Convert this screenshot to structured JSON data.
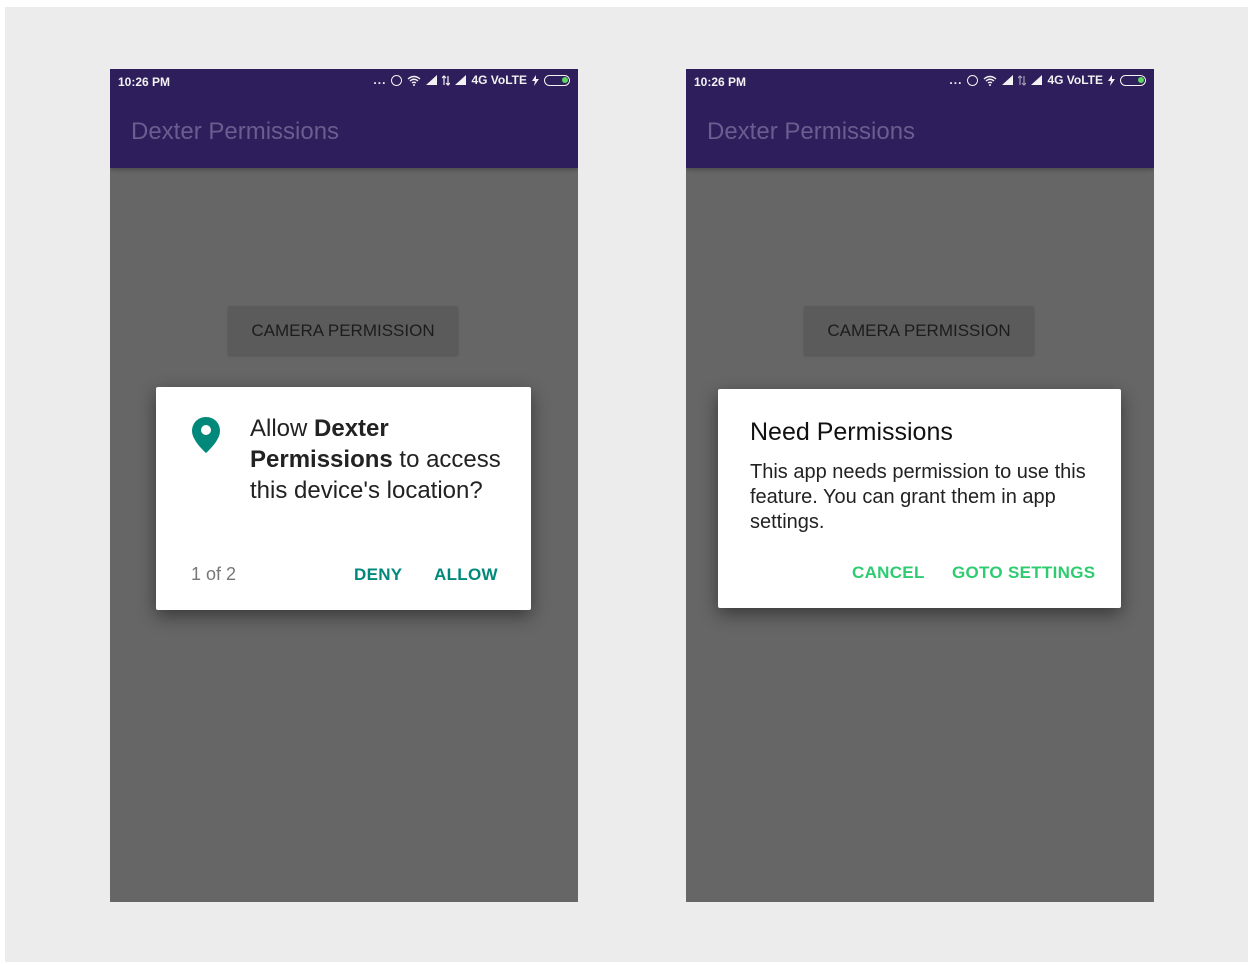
{
  "colors": {
    "app_bar": "#2e1e5b",
    "app_title": "#6a5d8f",
    "screen_scrim": "#666666",
    "allow_accent": "#00897b",
    "settings_accent": "#2ecc71",
    "battery_fill": "#5cd65c"
  },
  "screens": [
    {
      "status_bar": {
        "time": "10:26 PM",
        "dots": "...",
        "network": "4G VoLTE"
      },
      "app_title": "Dexter Permissions",
      "camera_button": "CAMERA PERMISSION",
      "dialog": {
        "type": "system-permission",
        "icon": "location-pin-icon",
        "text_prefix": "Allow ",
        "app_name": "Dexter Permissions",
        "text_suffix": " to access this device's location?",
        "counter": "1 of 2",
        "deny_label": "DENY",
        "allow_label": "ALLOW"
      }
    },
    {
      "status_bar": {
        "time": "10:26 PM",
        "dots": "...",
        "network": "4G VoLTE"
      },
      "app_title": "Dexter Permissions",
      "camera_button": "CAMERA PERMISSION",
      "dialog": {
        "type": "custom",
        "title": "Need Permissions",
        "message": "This app needs permission to use this feature. You can grant them in app settings.",
        "cancel_label": "CANCEL",
        "settings_label": "GOTO SETTINGS"
      }
    }
  ]
}
